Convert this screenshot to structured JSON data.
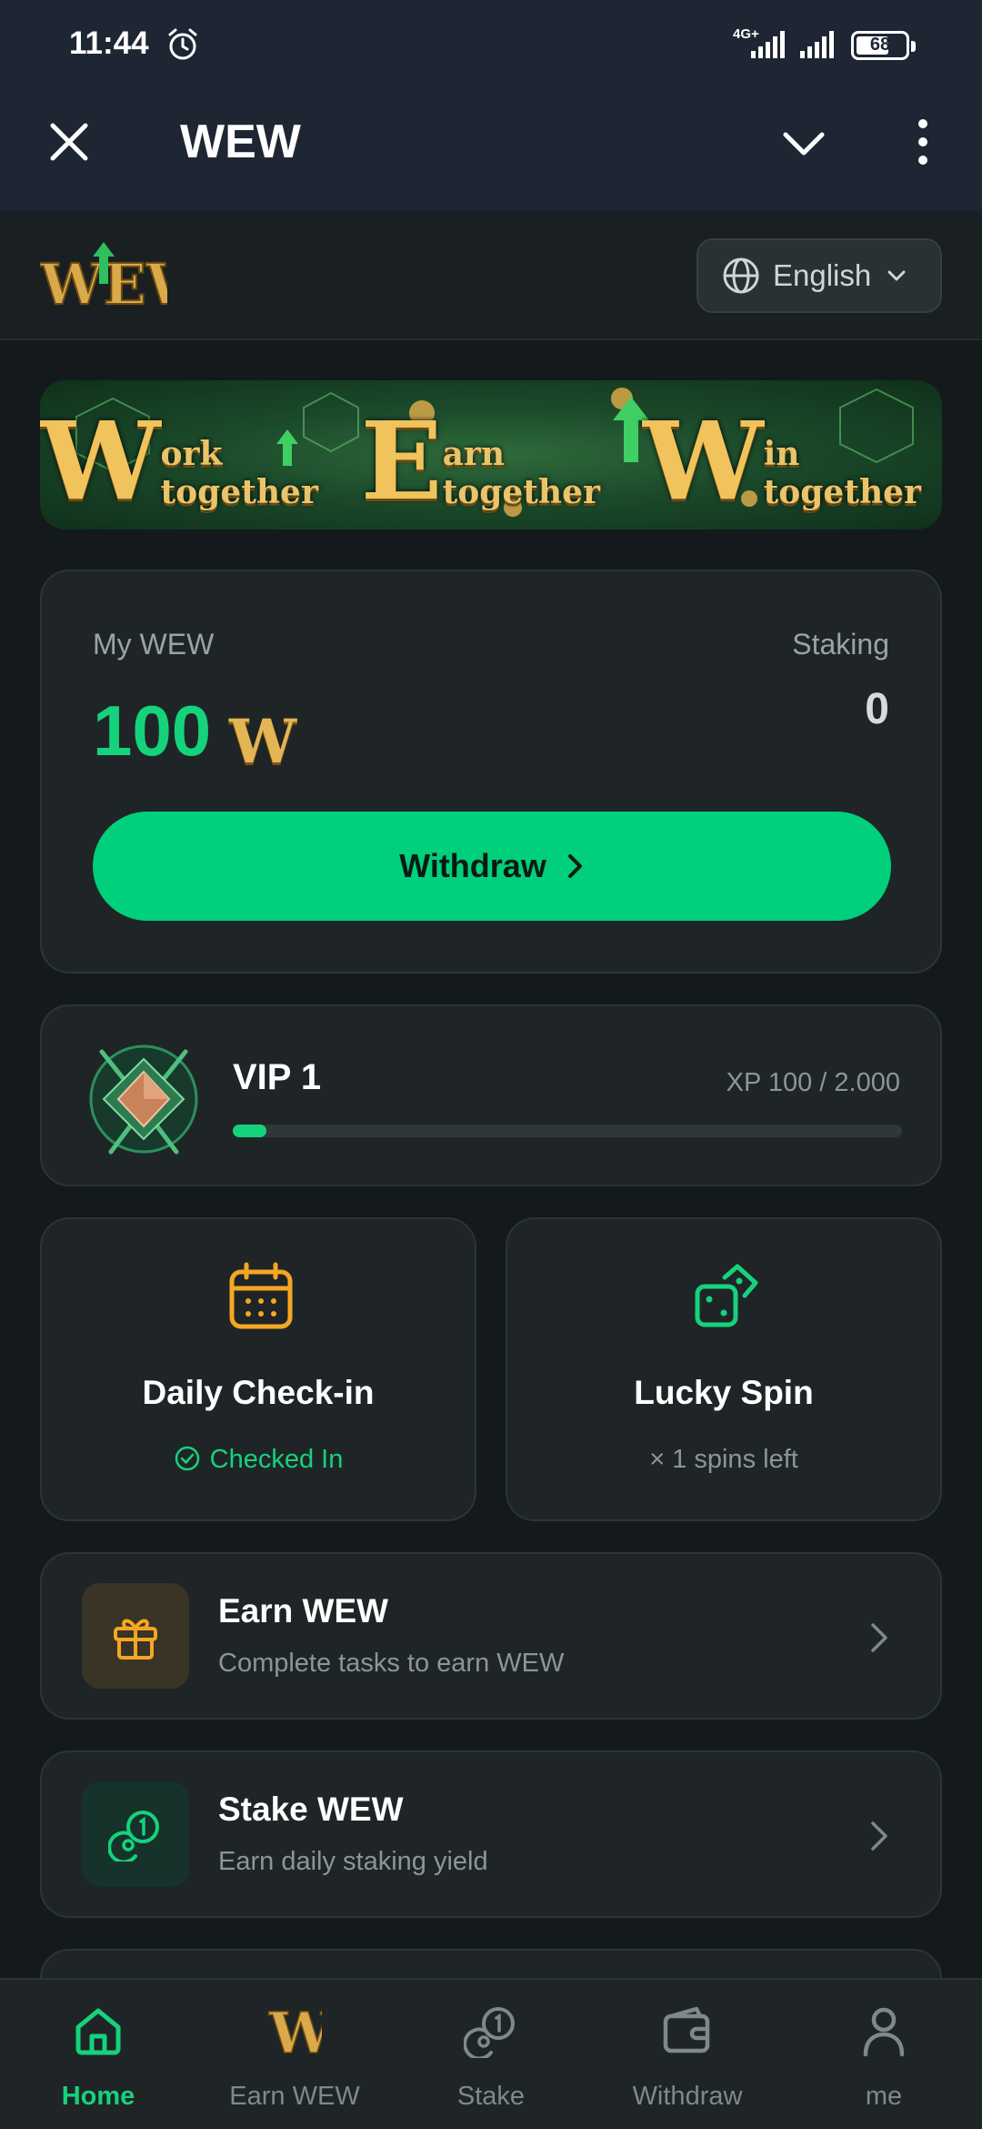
{
  "status_bar": {
    "time": "11:44",
    "network": "4G+",
    "battery": 68
  },
  "title_bar": {
    "title": "WEW"
  },
  "header": {
    "logo_text": "WEW",
    "language": "English"
  },
  "banner": {
    "segments": [
      {
        "letter": "W",
        "text": "ork together"
      },
      {
        "letter": "E",
        "text": "arn together"
      },
      {
        "letter": "W",
        "text": "in together"
      }
    ]
  },
  "wallet": {
    "label": "My WEW",
    "amount": "100",
    "coin_symbol": "W",
    "staking_label": "Staking",
    "staking_value": "0",
    "withdraw_label": "Withdraw"
  },
  "vip": {
    "level": "VIP 1",
    "xp_text": "XP 100 / 2.000",
    "progress": 0.05
  },
  "tiles": {
    "checkin": {
      "title": "Daily Check-in",
      "status": "Checked In"
    },
    "spin": {
      "title": "Lucky Spin",
      "status": "× 1 spins left"
    }
  },
  "rows": {
    "earn": {
      "title": "Earn WEW",
      "subtitle": "Complete tasks to earn WEW"
    },
    "stake": {
      "title": "Stake WEW",
      "subtitle": "Earn daily staking yield"
    }
  },
  "nav": [
    {
      "label": "Home",
      "icon": "home-icon",
      "active": true
    },
    {
      "label": "Earn WEW",
      "icon": "wew-coin-icon",
      "active": false
    },
    {
      "label": "Stake",
      "icon": "stake-coins-icon",
      "active": false
    },
    {
      "label": "Withdraw",
      "icon": "wallet-icon",
      "active": false
    },
    {
      "label": "me",
      "icon": "user-icon",
      "active": false
    }
  ],
  "colors": {
    "accent": "#00d07b",
    "gold": "#e3b554",
    "background": "#141a1b",
    "card": "#1f2527"
  }
}
